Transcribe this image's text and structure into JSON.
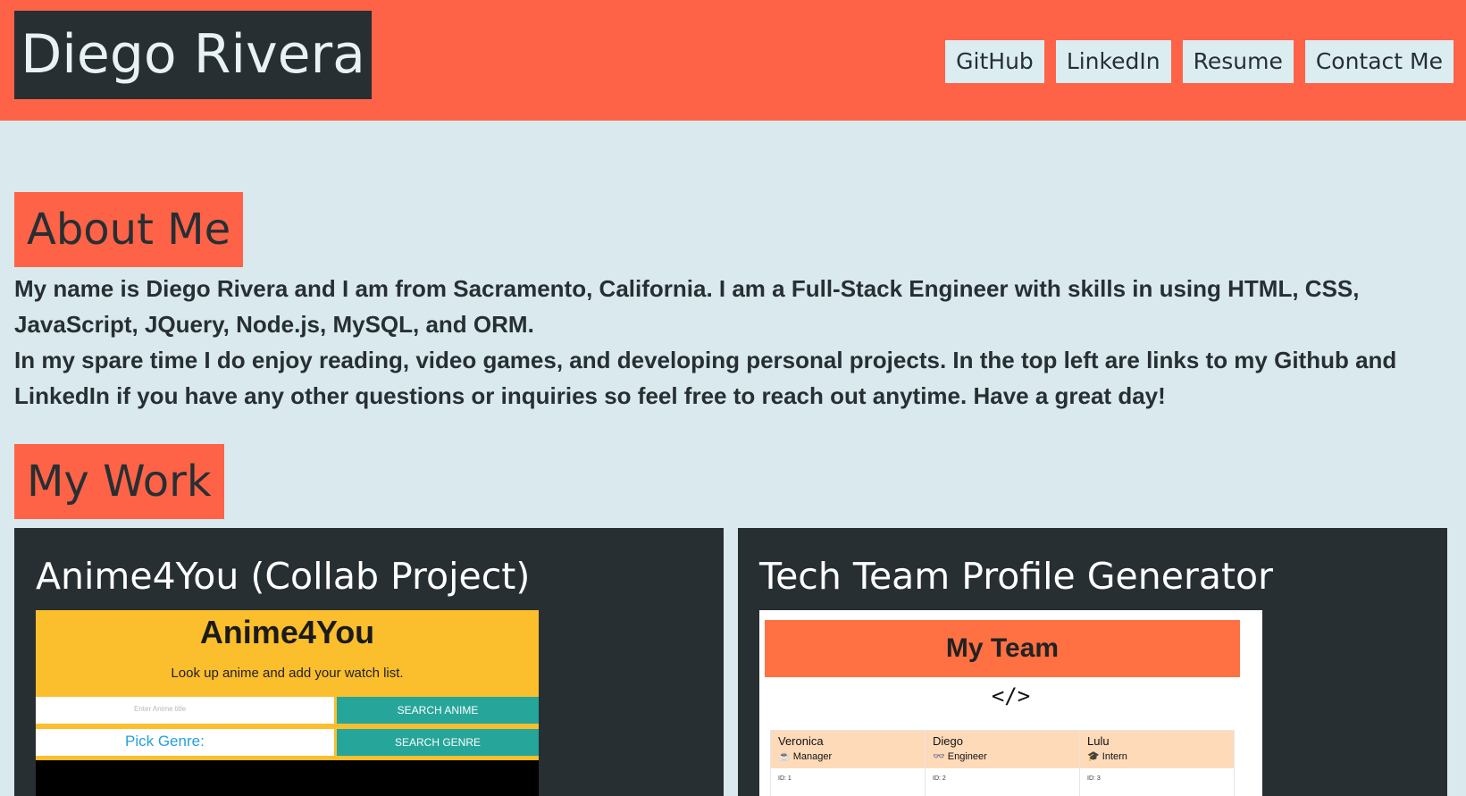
{
  "header": {
    "brand": "Diego Rivera",
    "nav": [
      {
        "label": "GitHub"
      },
      {
        "label": "LinkedIn"
      },
      {
        "label": "Resume"
      },
      {
        "label": "Contact Me"
      }
    ]
  },
  "about": {
    "heading": "About Me",
    "paragraph1": "My name is Diego Rivera and I am from Sacramento, California. I am a Full-Stack Engineer with skills in using HTML, CSS, JavaScript, JQuery, Node.js, MySQL, and ORM.",
    "paragraph2": "In my spare time I do enjoy reading, video games, and developing personal projects. In the top left are links to my Github and LinkedIn if you have any other questions or inquiries so feel free to reach out anytime. Have a great day!"
  },
  "work": {
    "heading": "My Work",
    "projects": [
      {
        "title": "Anime4You (Collab Project)",
        "preview": {
          "title": "Anime4You",
          "subtitle": "Look up anime and add your watch list.",
          "search_placeholder": "Enter Anime title",
          "search_button": "SEARCH ANIME",
          "genre_label": "Pick Genre:",
          "genre_button": "SEARCH GENRE"
        }
      },
      {
        "title": "Tech Team Profile Generator",
        "preview": {
          "banner": "My Team",
          "code_icon": "</>",
          "members": [
            {
              "name": "Veronica",
              "role": "Manager",
              "role_icon": "☕",
              "id": "ID: 1"
            },
            {
              "name": "Diego",
              "role": "Engineer",
              "role_icon": "👓",
              "id": "ID: 2"
            },
            {
              "name": "Lulu",
              "role": "Intern",
              "role_icon": "🎓",
              "id": "ID: 3"
            }
          ]
        }
      }
    ]
  },
  "colors": {
    "accent": "#ff6347",
    "dark": "#272f33",
    "background": "#d9e9ee"
  }
}
